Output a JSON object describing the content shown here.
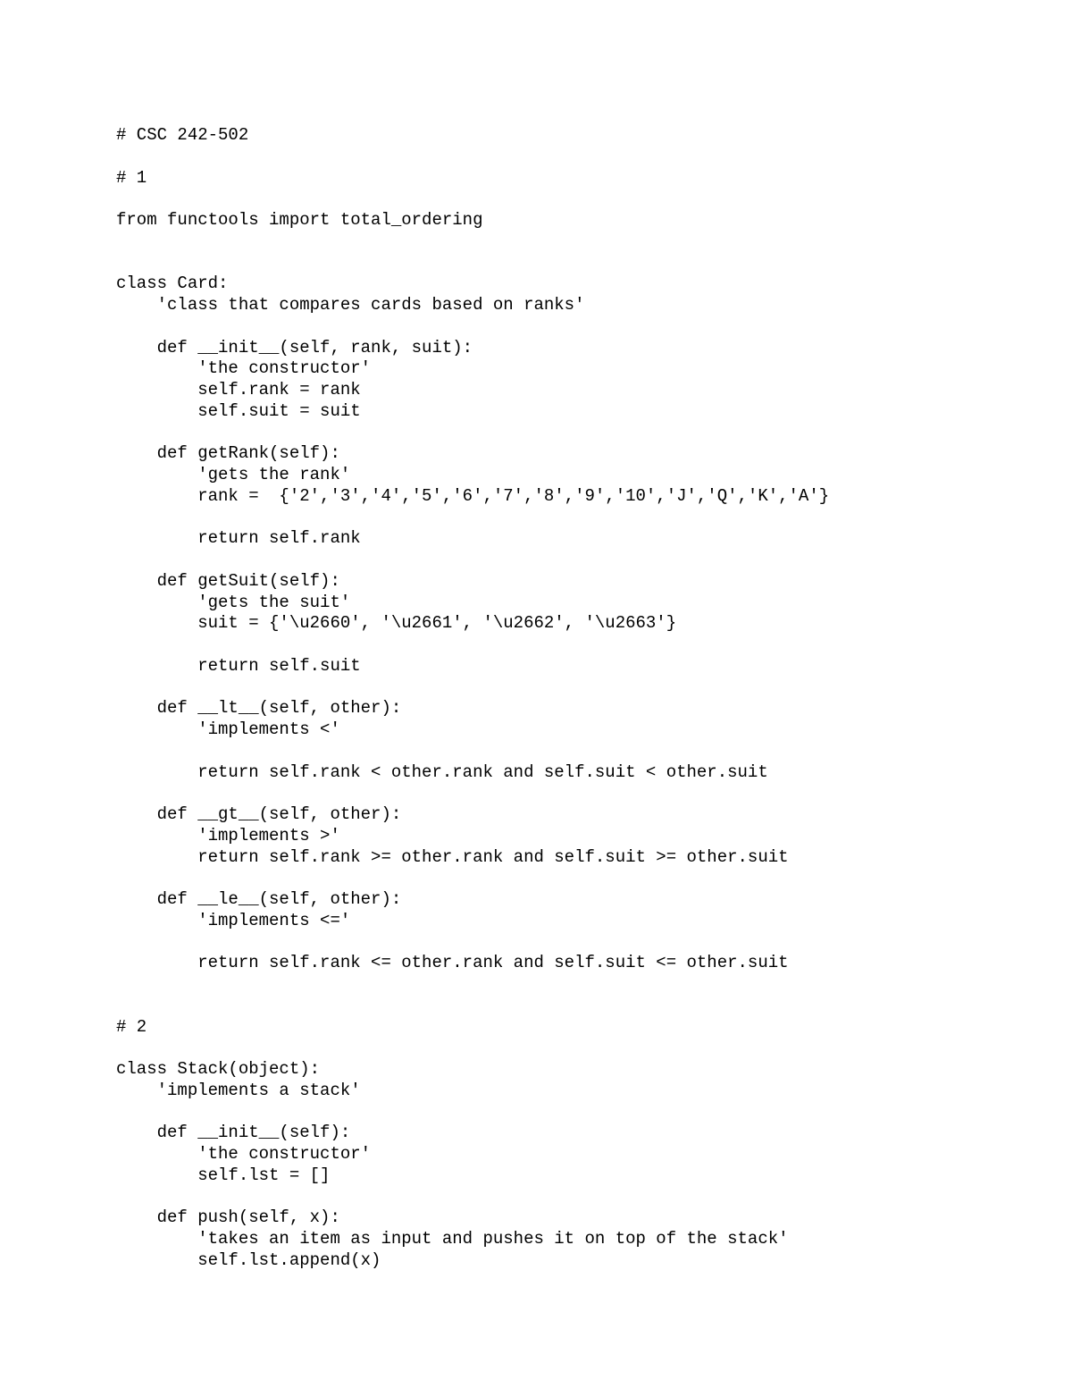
{
  "code": {
    "lines": [
      "# CSC 242-502",
      "",
      "# 1",
      "",
      "from functools import total_ordering",
      "",
      "",
      "class Card:",
      "    'class that compares cards based on ranks'",
      "",
      "    def __init__(self, rank, suit):",
      "        'the constructor'",
      "        self.rank = rank",
      "        self.suit = suit",
      "",
      "    def getRank(self):",
      "        'gets the rank'",
      "        rank =  {'2','3','4','5','6','7','8','9','10','J','Q','K','A'}",
      "",
      "        return self.rank",
      "",
      "    def getSuit(self):",
      "        'gets the suit'",
      "        suit = {'\\u2660', '\\u2661', '\\u2662', '\\u2663'}",
      "",
      "        return self.suit",
      "",
      "    def __lt__(self, other):",
      "        'implements <'",
      "",
      "        return self.rank < other.rank and self.suit < other.suit",
      "",
      "    def __gt__(self, other):",
      "        'implements >'",
      "        return self.rank >= other.rank and self.suit >= other.suit",
      "",
      "    def __le__(self, other):",
      "        'implements <='",
      "",
      "        return self.rank <= other.rank and self.suit <= other.suit",
      "",
      "",
      "# 2",
      "",
      "class Stack(object):",
      "    'implements a stack'",
      "",
      "    def __init__(self):",
      "        'the constructor'",
      "        self.lst = []",
      "",
      "    def push(self, x):",
      "        'takes an item as input and pushes it on top of the stack'",
      "        self.lst.append(x)"
    ]
  }
}
